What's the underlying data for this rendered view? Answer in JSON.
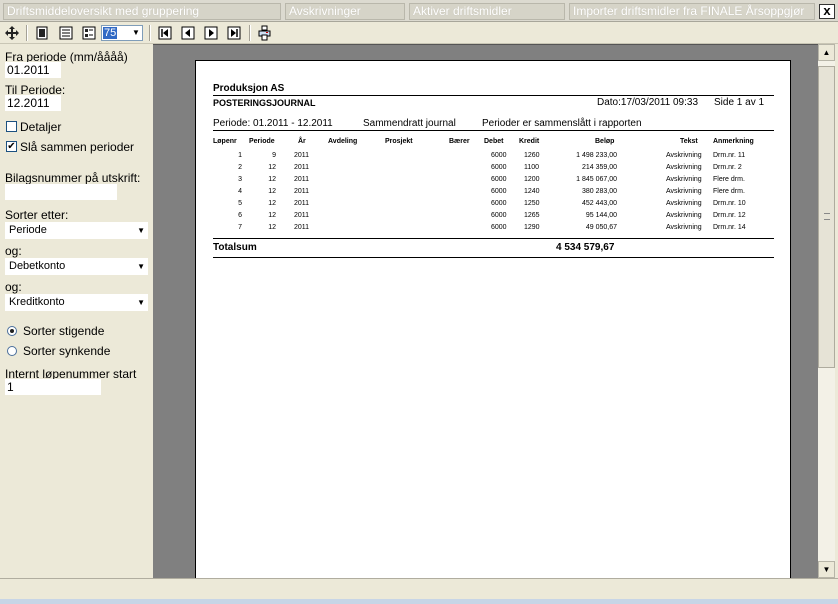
{
  "tabs": [
    "Driftsmiddeloversikt med gruppering",
    "Avskrivninger",
    "Aktiver driftsmidler",
    "Importer driftsmidler fra FINALE Årsoppgjør"
  ],
  "close_label": "x",
  "toolbar": {
    "zoom": "75"
  },
  "left": {
    "fra_periode_label": "Fra periode (mm/åååå)",
    "fra_periode_value": "01.2011",
    "til_periode_label": "Til Periode:",
    "til_periode_value": "12.2011",
    "detaljer_label": "Detaljer",
    "detaljer_checked": false,
    "sla_sammen_label": "Slå sammen perioder",
    "sla_sammen_checked": true,
    "bilagsnummer_label": "Bilagsnummer på utskrift:",
    "bilagsnummer_value": "",
    "sorter_etter_label": "Sorter etter:",
    "sort1": "Periode",
    "og1_label": "og:",
    "sort2": "Debetkonto",
    "og2_label": "og:",
    "sort3": "Kreditkonto",
    "stigende_label": "Sorter stigende",
    "synkende_label": "Sorter synkende",
    "sort_order": "stigende",
    "lopenummer_label": "Internt løpenummer start",
    "lopenummer_value": "1"
  },
  "report": {
    "company": "Produksjon AS",
    "title": "POSTERINGSJOURNAL",
    "dato": "Dato:17/03/2011 09:33",
    "side": "Side 1 av 1",
    "periode": "Periode: 01.2011 - 12.2011",
    "journal_type": "Sammendratt journal",
    "note": "Perioder er sammenslått i rapporten",
    "columns": {
      "lopenr": "Løpenr",
      "periode": "Periode",
      "ar": "År",
      "avdeling": "Avdeling",
      "prosjekt": "Prosjekt",
      "baerer": "Bærer",
      "debet": "Debet",
      "kredit": "Kredit",
      "belop": "Beløp",
      "tekst": "Tekst",
      "anmerkning": "Anmerkning"
    },
    "rows": [
      {
        "lopenr": "1",
        "periode": "9",
        "ar": "2011",
        "debet": "6000",
        "kredit": "1260",
        "belop": "1 498 233,00",
        "tekst": "Avskrivning",
        "anmerkning": "Drm.nr. 11"
      },
      {
        "lopenr": "2",
        "periode": "12",
        "ar": "2011",
        "debet": "6000",
        "kredit": "1100",
        "belop": "214 359,00",
        "tekst": "Avskrivning",
        "anmerkning": "Drm.nr. 2"
      },
      {
        "lopenr": "3",
        "periode": "12",
        "ar": "2011",
        "debet": "6000",
        "kredit": "1200",
        "belop": "1 845 067,00",
        "tekst": "Avskrivning",
        "anmerkning": "Flere drm."
      },
      {
        "lopenr": "4",
        "periode": "12",
        "ar": "2011",
        "debet": "6000",
        "kredit": "1240",
        "belop": "380 283,00",
        "tekst": "Avskrivning",
        "anmerkning": "Flere drm."
      },
      {
        "lopenr": "5",
        "periode": "12",
        "ar": "2011",
        "debet": "6000",
        "kredit": "1250",
        "belop": "452 443,00",
        "tekst": "Avskrivning",
        "anmerkning": "Drm.nr. 10"
      },
      {
        "lopenr": "6",
        "periode": "12",
        "ar": "2011",
        "debet": "6000",
        "kredit": "1265",
        "belop": "95 144,00",
        "tekst": "Avskrivning",
        "anmerkning": "Drm.nr. 12"
      },
      {
        "lopenr": "7",
        "periode": "12",
        "ar": "2011",
        "debet": "6000",
        "kredit": "1290",
        "belop": "49 050,67",
        "tekst": "Avskrivning",
        "anmerkning": "Drm.nr. 14"
      }
    ],
    "totalsum_label": "Totalsum",
    "totalsum_value": "4 534 579,67"
  }
}
